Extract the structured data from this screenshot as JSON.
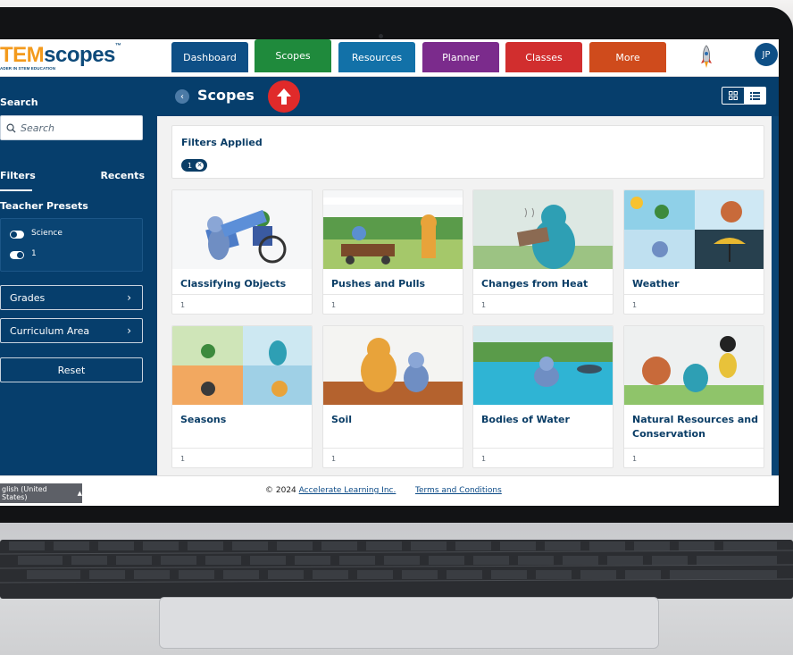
{
  "app": {
    "logo_text_a": "TEM",
    "logo_text_b": "scopes",
    "logo_tm": "™",
    "logo_tagline": "ADER IN STEM EDUCATION",
    "brand_colors": {
      "navy": "#063e6c",
      "orange": "#f39a1c",
      "alert_red": "#e02a2a"
    }
  },
  "nav": {
    "items": [
      {
        "label": "Dashboard",
        "color": "#0e4f86",
        "active": false
      },
      {
        "label": "Scopes",
        "color": "#1f8a3c",
        "active": true
      },
      {
        "label": "Resources",
        "color": "#1271a8",
        "active": false
      },
      {
        "label": "Planner",
        "color": "#7b2b8c",
        "active": false
      },
      {
        "label": "Classes",
        "color": "#d12e2e",
        "active": false
      },
      {
        "label": "More",
        "color": "#cf4b1c",
        "active": false
      }
    ],
    "avatar_initials": "JP",
    "rocket_icon": "rocket-icon"
  },
  "sidebar": {
    "search_label": "Search",
    "search_placeholder": "Search",
    "tabs": {
      "filters": "Filters",
      "recents": "Recents"
    },
    "teacher_presets_label": "Teacher Presets",
    "presets": [
      {
        "label": "Science",
        "on": false
      },
      {
        "label": "1",
        "on": true
      }
    ],
    "grades_label": "Grades",
    "curriculum_label": "Curriculum Area",
    "reset_label": "Reset"
  },
  "main": {
    "page_title": "Scopes",
    "view_modes": [
      "grid",
      "list"
    ],
    "active_view": "grid",
    "filters_title": "Filters Applied",
    "filters_count": "1"
  },
  "cards": [
    {
      "title": "Classifying Objects",
      "count": "1",
      "image": "classifying-objects-illustration"
    },
    {
      "title": "Pushes and Pulls",
      "count": "1",
      "image": "pushes-and-pulls-illustration"
    },
    {
      "title": "Changes from Heat",
      "count": "1",
      "image": "changes-from-heat-illustration"
    },
    {
      "title": "Weather",
      "count": "1",
      "image": "weather-illustration"
    },
    {
      "title": "Seasons",
      "count": "1",
      "image": "seasons-illustration"
    },
    {
      "title": "Soil",
      "count": "1",
      "image": "soil-illustration"
    },
    {
      "title": "Bodies of Water",
      "count": "1",
      "image": "bodies-of-water-illustration"
    },
    {
      "title": "Natural Resources and Conservation",
      "count": "1",
      "image": "natural-resources-illustration"
    }
  ],
  "footer": {
    "language": "glish (United States)",
    "copyright_prefix": "© 2024",
    "company_link": "Accelerate Learning Inc.",
    "terms_link": "Terms and Conditions"
  }
}
